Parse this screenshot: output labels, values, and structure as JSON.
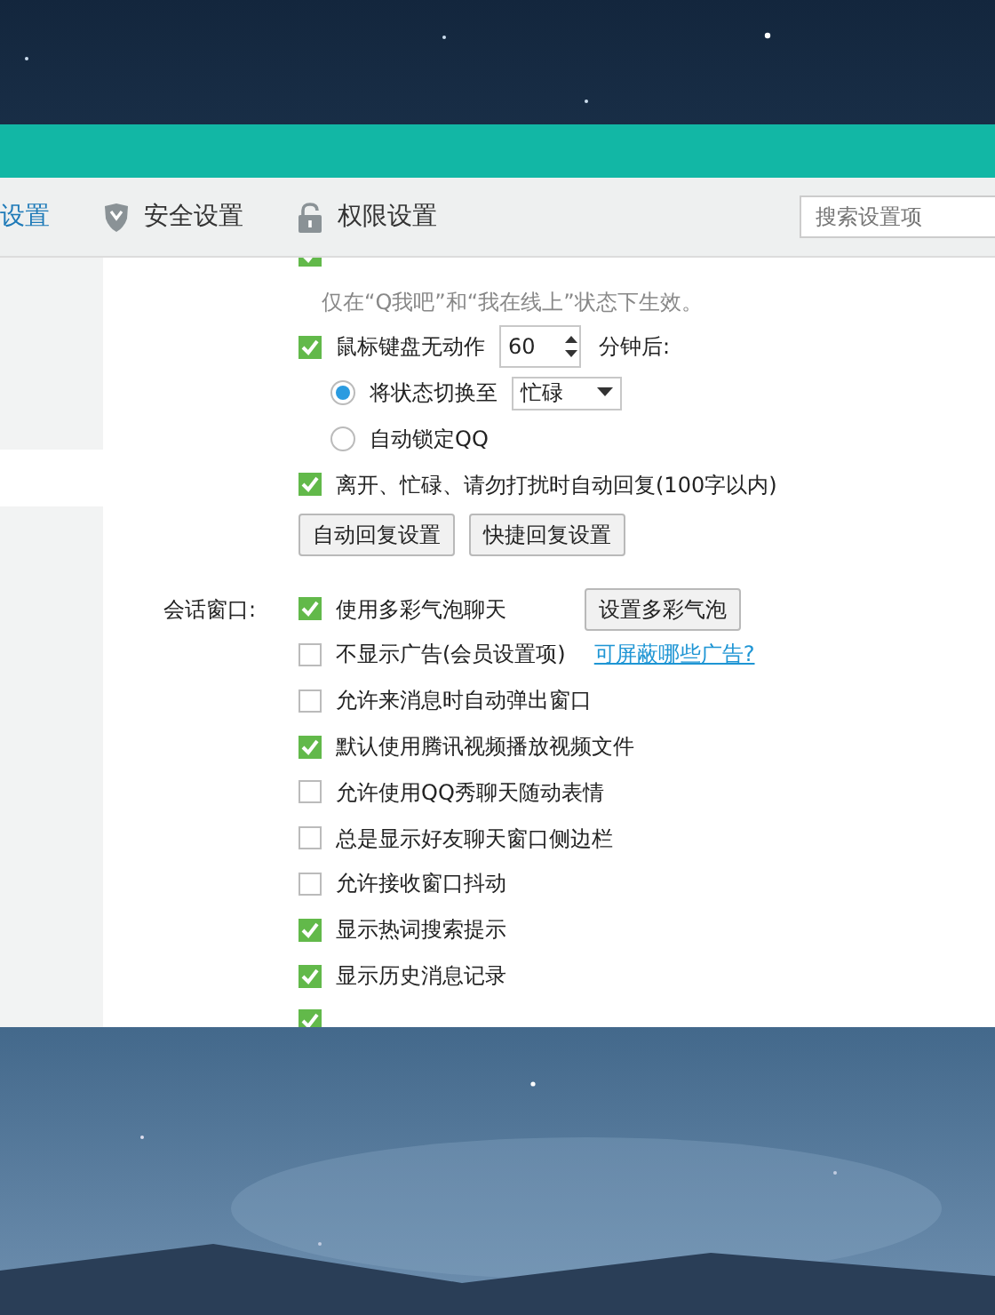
{
  "toolbar": {
    "tabs": [
      {
        "label": "设置",
        "selected": true
      },
      {
        "label": "安全设置",
        "selected": false
      },
      {
        "label": "权限设置",
        "selected": false
      }
    ],
    "search": {
      "placeholder": "搜索设置项"
    }
  },
  "sidebar": {
    "items": [
      {
        "selected": true
      }
    ]
  },
  "rows": [
    {
      "kind": "checkbox",
      "checked": true
    },
    {
      "kind": "note",
      "text": "仅在“Q我吧”和“我在线上”状态下生效。"
    },
    {
      "kind": "spinner",
      "label": "鼠标键盘无动作",
      "checked": true,
      "value": "60",
      "suffix": "分钟后:"
    },
    {
      "kind": "radio",
      "label": "将状态切换至",
      "selected": true,
      "dropdown": "忙碌"
    },
    {
      "kind": "radio",
      "label": "自动锁定QQ",
      "selected": false
    },
    {
      "kind": "checkbox",
      "label": "离开、忙碌、请勿打扰时自动回复(100字以内)",
      "checked": true
    },
    {
      "kind": "buttons",
      "buttons": [
        "自动回复设置",
        "快捷回复设置"
      ]
    },
    {
      "kind": "checkbox",
      "section": "会话窗口:",
      "label": "使用多彩气泡聊天",
      "checked": true,
      "button": "设置多彩气泡"
    },
    {
      "kind": "checkbox",
      "label": "不显示广告(会员设置项)",
      "checked": false,
      "link": "可屏蔽哪些广告?"
    },
    {
      "kind": "checkbox",
      "label": "允许来消息时自动弹出窗口",
      "checked": false
    },
    {
      "kind": "checkbox",
      "label": "默认使用腾讯视频播放视频文件",
      "checked": true
    },
    {
      "kind": "checkbox",
      "label": "允许使用QQ秀聊天随动表情",
      "checked": false
    },
    {
      "kind": "checkbox",
      "label": "总是显示好友聊天窗口侧边栏",
      "checked": false
    },
    {
      "kind": "checkbox",
      "label": "允许接收窗口抖动",
      "checked": false
    },
    {
      "kind": "checkbox",
      "label": "显示热词搜索提示",
      "checked": true
    },
    {
      "kind": "checkbox",
      "label": "显示历史消息记录",
      "checked": true
    },
    {
      "kind": "checkbox",
      "checked": true
    }
  ]
}
